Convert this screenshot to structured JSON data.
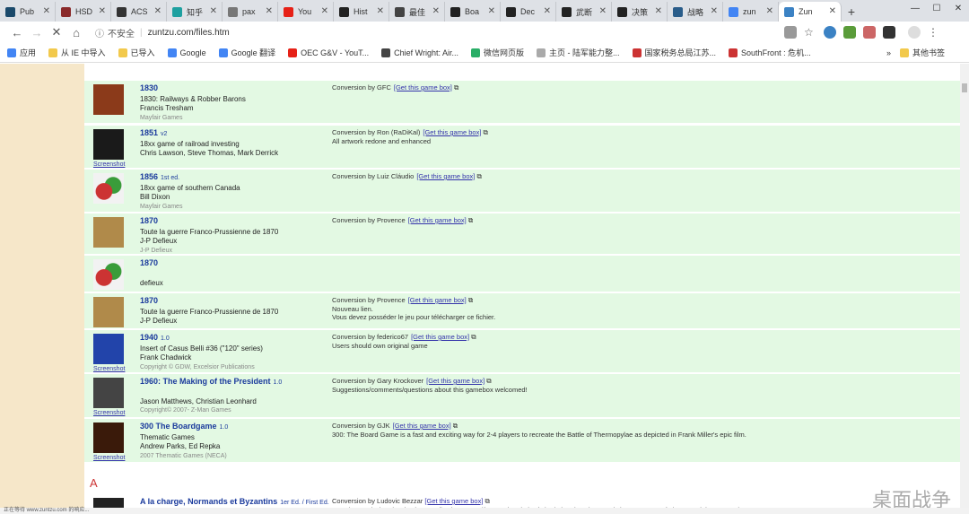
{
  "tabs": [
    {
      "label": "Pub",
      "color": "#1b4a6b"
    },
    {
      "label": "HSD",
      "color": "#8a2a2a"
    },
    {
      "label": "ACS",
      "color": "#333"
    },
    {
      "label": "知乎",
      "color": "#1ea0a0"
    },
    {
      "label": "pax",
      "color": "#777"
    },
    {
      "label": "You",
      "color": "#e62117"
    },
    {
      "label": "Hist",
      "color": "#222"
    },
    {
      "label": "最佳",
      "color": "#444"
    },
    {
      "label": "Boa",
      "color": "#222"
    },
    {
      "label": "Dec",
      "color": "#222"
    },
    {
      "label": "武断",
      "color": "#222"
    },
    {
      "label": "决策",
      "color": "#222"
    },
    {
      "label": "战略",
      "color": "#2a5d8a"
    },
    {
      "label": "zun",
      "color": "#4285f4"
    },
    {
      "label": "Zun",
      "color": "#3b82c4"
    }
  ],
  "toolbar": {
    "security": "不安全",
    "url": "zuntzu.com/files.htm"
  },
  "bookmarks": [
    {
      "label": "应用",
      "color": "#4285f4"
    },
    {
      "label": "从 IE 中导入",
      "color": "#f2c94c"
    },
    {
      "label": "已导入",
      "color": "#f2c94c"
    },
    {
      "label": "Google",
      "color": "#4285f4"
    },
    {
      "label": "Google 翻译",
      "color": "#4285f4"
    },
    {
      "label": "OEC G&V - YouT...",
      "color": "#e62117"
    },
    {
      "label": "Chief Wright: Air...",
      "color": "#444"
    },
    {
      "label": "微信网页版",
      "color": "#2aae67"
    },
    {
      "label": "主页 - 陆军能力整...",
      "color": "#aaa"
    },
    {
      "label": "国家税务总局江苏...",
      "color": "#c33"
    },
    {
      "label": "SouthFront : 危机...",
      "color": "#c33"
    }
  ],
  "bookmarks_more": "»",
  "bookmarks_other": "其他书签",
  "rows": [
    {
      "name": "1830",
      "version": "",
      "line1": "1830: Railways & Robber Barons",
      "line2": "Francis Tresham",
      "publisher": "Mayfair Games",
      "screenshot": "",
      "conversion": "Conversion by GFC",
      "link": "[Get this game box]",
      "note": "",
      "thumb": "#8b3a1a"
    },
    {
      "name": "1851",
      "version": "v2",
      "line1": "18xx game of railroad investing",
      "line2": "Chris Lawson, Steve Thomas, Mark Derrick",
      "publisher": "",
      "screenshot": "Screenshot",
      "conversion": "Conversion by Ron (RaDiKal)",
      "link": "[Get this game box]",
      "note": "All artwork redone and enhanced",
      "thumb": "#1a1a1a"
    },
    {
      "name": "1856",
      "version": "1st ed.",
      "line1": "18xx game of southern Canada",
      "line2": "Bill Dixon",
      "publisher": "Mayfair Games",
      "screenshot": "",
      "conversion": "Conversion by Luiz Cláudio",
      "link": "[Get this game box]",
      "note": "",
      "thumb": "#cc3333"
    },
    {
      "name": "1870",
      "version": "",
      "line1": "Toute la guerre Franco-Prussienne de 1870",
      "line2": "J-P Defieux",
      "publisher": "J-P Defieux",
      "screenshot": "",
      "conversion": "Conversion by Provence",
      "link": "[Get this game box]",
      "note": "",
      "thumb": "#b08a4a"
    },
    {
      "name": "1870",
      "version": "",
      "line1": "",
      "line2": "defieux",
      "publisher": "",
      "screenshot": "",
      "conversion": "",
      "link": "",
      "note": "",
      "thumb": "#cc3333"
    },
    {
      "name": "1870",
      "version": "",
      "line1": "Toute la guerre Franco-Prussienne de 1870",
      "line2": "J-P Defieux",
      "publisher": "",
      "screenshot": "",
      "conversion": "Conversion by Provence",
      "link": "[Get this game box]",
      "note": "Nouveau lien.\nVous devez posséder le jeu pour télécharger ce fichier.",
      "thumb": "#b08a4a"
    },
    {
      "name": "1940",
      "version": "1.0",
      "line1": "Insert of Casus Belli #36 (\"120\" series)",
      "line2": "Frank Chadwick",
      "publisher": "Copyright © GDW, Excelsior Publications",
      "screenshot": "Screenshot",
      "conversion": "Conversion by federico67",
      "link": "[Get this game box]",
      "note": "Users should own original game",
      "thumb": "#2244aa"
    },
    {
      "name": "1960: The Making of the President",
      "version": "1.0",
      "line1": "",
      "line2": "Jason Matthews, Christian Leonhard",
      "publisher": "Copyright© 2007- Z-Man Games",
      "screenshot": "Screenshot",
      "conversion": "Conversion by Gary Krockover",
      "link": "[Get this game box]",
      "note": "Suggestions/comments/questions about this gamebox welcomed!",
      "thumb": "#444"
    },
    {
      "name": "300 The Boardgame",
      "version": "1.0",
      "line1": "Thematic Games",
      "line2": "Andrew Parks, Ed Repka",
      "publisher": "2007 Thematic Games (NECA)",
      "screenshot": "Screenshot",
      "conversion": "Conversion by GJK",
      "link": "[Get this game box]",
      "note": "300: The Board Game is a fast and exciting way for 2-4 players to recreate the Battle of Thermopylae as depicted in Frank Miller's epic film.",
      "thumb": "#3a1a0a"
    }
  ],
  "letter": "A",
  "last_row": {
    "name": "A la charge, Normands et Byzantins",
    "version": "1er Ed. / First Ed.",
    "conversion": "Conversion by Ludovic Bezzar",
    "link": "[Get this game box]",
    "note": "Avec la permission de Histoire & Collections. Dernière version de la règle du jeu dans le Vae Victis n° 100. Les règle en anglais sont sur le"
  },
  "watermark": "桌面战争",
  "status": "正在等待 www.zuntzu.com 的响应..."
}
